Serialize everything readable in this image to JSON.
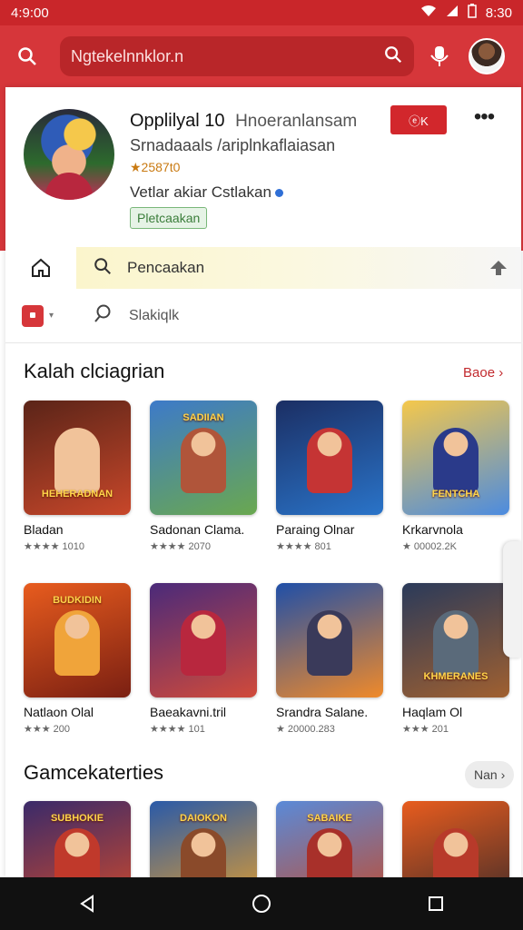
{
  "status_bar": {
    "time_left": "4:9:00",
    "time_right": "8:30"
  },
  "search": {
    "value": "Ngtekelnnklor.n"
  },
  "profile": {
    "name": "Opplilyal 10",
    "name_secondary": "Hnoeranlansam",
    "subtitle": "Srnadaaals /ariplnkaflaiasan",
    "rating": "★2587t0",
    "developer": "Vetlar akiar Cstlakan",
    "badge": "Pletcaakan",
    "action_label": "ⓔK"
  },
  "filters": {
    "primary_label": "Pencaakan",
    "secondary_label": "Slakiqlk"
  },
  "sections": [
    {
      "title": "Kalah clciagrian",
      "link": "Baoe",
      "tiles": [
        {
          "name": "Bladan",
          "rating": "★★★★ 1010",
          "banner": "HEHERADNAN",
          "colors": [
            "#5a2418",
            "#c8472a"
          ],
          "figure": "#f1c39a"
        },
        {
          "name": "Sadonan Clama.",
          "rating": "★★★★ 2070",
          "banner": "SADIIAN",
          "banner_top": true,
          "colors": [
            "#3d7ac9",
            "#6aa84f"
          ],
          "figure": "#b0553a"
        },
        {
          "name": "Paraing Olnar",
          "rating": "★★★★ 801",
          "banner": "",
          "colors": [
            "#1b2e63",
            "#2a74c9"
          ],
          "figure": "#c53434"
        },
        {
          "name": "Krkarvnola",
          "rating": "★ 00002.2K",
          "banner": "FENTCHA",
          "colors": [
            "#f5c84b",
            "#4b8be0"
          ],
          "figure": "#2a3a8a"
        }
      ]
    },
    {
      "title": "",
      "link": "",
      "tiles": [
        {
          "name": "Natlaon Olal",
          "rating": "★★★ 200",
          "banner": "BUDKIDIN",
          "banner_top": true,
          "colors": [
            "#e85c1e",
            "#7a1f12"
          ],
          "figure": "#f0a43a"
        },
        {
          "name": "Baeakavni.tril",
          "rating": "★★★★ 101",
          "banner": "",
          "colors": [
            "#4a2a7a",
            "#d14a3a"
          ],
          "figure": "#b8273e"
        },
        {
          "name": "Srandra Salane.",
          "rating": "★ 20000.283",
          "banner": "",
          "colors": [
            "#1f4fa8",
            "#f08a2a"
          ],
          "figure": "#3a3a5a"
        },
        {
          "name": "Haqlam Ol",
          "rating": "★★★ 201",
          "banner": "KHMERANES",
          "colors": [
            "#2a3a5a",
            "#a06030"
          ],
          "figure": "#5a6a7a"
        }
      ]
    },
    {
      "title": "Gamcekaterties",
      "link": "Nan",
      "tiles": [
        {
          "name": "",
          "rating": "",
          "banner": "SUBHOKIE",
          "banner_top": true,
          "colors": [
            "#3a2a6a",
            "#d14a2a"
          ],
          "figure": "#c0392b"
        },
        {
          "name": "",
          "rating": "",
          "banner": "DAIOKON",
          "banner_top": true,
          "colors": [
            "#2a5aa8",
            "#e8a02a"
          ],
          "figure": "#8a4a2a"
        },
        {
          "name": "",
          "rating": "",
          "banner": "SABAIKE",
          "banner_top": true,
          "colors": [
            "#5a8ad8",
            "#c44a2a"
          ],
          "figure": "#a8302a"
        },
        {
          "name": "",
          "rating": "",
          "banner": "",
          "colors": [
            "#e85c1e",
            "#3a2a2a"
          ],
          "figure": "#b83a2a"
        }
      ]
    }
  ],
  "colors": {
    "brand": "#d6363a",
    "brand_dark": "#b92629",
    "link": "#c22a2e",
    "star": "#e7a21a"
  }
}
